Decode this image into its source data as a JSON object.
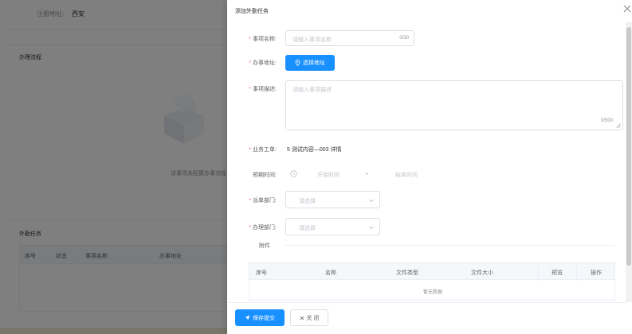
{
  "background": {
    "top_label": "注册地址:",
    "top_value": "西安",
    "section1_title": "办理流程",
    "empty_text": "该事项未配置办事流程",
    "section2_title": "外勤任务",
    "table_headers": [
      "序号",
      "状态",
      "事项名称",
      "办事地址"
    ]
  },
  "drawer": {
    "title": "添加外勤任务",
    "close_icon": "close-icon"
  },
  "form": {
    "name": {
      "label": "事项名称:",
      "placeholder": "请输入事项名称",
      "count": "0/30"
    },
    "address": {
      "label": "办事地址:",
      "button_label": "选择地址",
      "icon": "location-icon"
    },
    "description": {
      "label": "事项描述:",
      "placeholder": "请输入事项描述",
      "count": "0/500"
    },
    "work_order": {
      "label": "业务工单:",
      "value": "5 测试内容—003   详情"
    },
    "deadline": {
      "label": "预期时间:",
      "start_placeholder": "开始时间",
      "separator": "-",
      "end_placeholder": "结束时间"
    },
    "dispatch_dept": {
      "label": "派单部门:",
      "placeholder": "请选择"
    },
    "handle_dept": {
      "label": "办理部门:",
      "placeholder": "请选择"
    },
    "attachment": {
      "label": "附件"
    }
  },
  "attachment_table": {
    "headers": [
      "序号",
      "名称",
      "文件类型",
      "文件大小",
      "预览",
      "操作"
    ],
    "empty_text": "暂无数据"
  },
  "footer": {
    "save_label": "保存提交",
    "close_label": "关 闭"
  },
  "colors": {
    "primary": "#1890ff",
    "required": "#f56c6c"
  }
}
